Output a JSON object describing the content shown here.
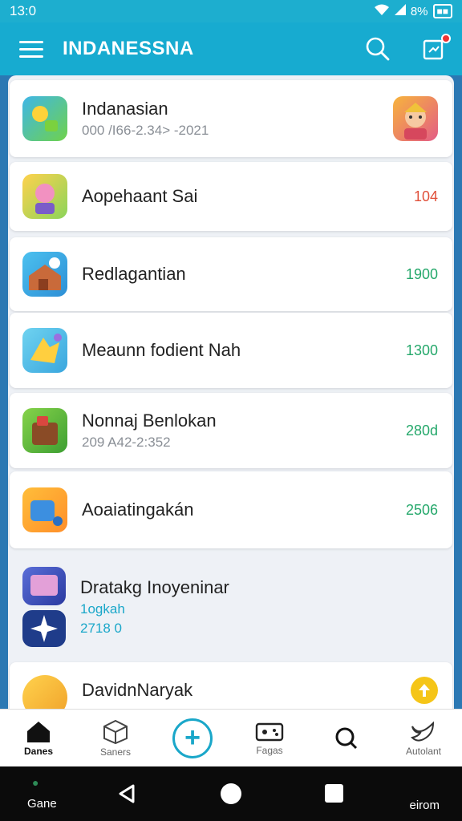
{
  "status": {
    "time": "13:0",
    "battery": "8%"
  },
  "header": {
    "title": "INDANESSNA"
  },
  "items": [
    {
      "name": "Indanasian",
      "sub": "000 /I66-2.34> -2021",
      "value": ""
    },
    {
      "name": "Aopehaant Sai",
      "sub": "",
      "value": "104",
      "value_color": "#e0503a"
    },
    {
      "name": "Redlagantian",
      "sub": "",
      "value": "1900",
      "value_color": "#25a86b"
    },
    {
      "name": "Meaunn fodient Nah",
      "sub": "",
      "value": "1300",
      "value_color": "#25a86b"
    },
    {
      "name": "Nonnaj Benlokan",
      "sub": "209 A42-2:352",
      "value": "280d",
      "value_color": "#25a86b"
    },
    {
      "name": "Aoaiatingakán",
      "sub": "",
      "value": "2506",
      "value_color": "#25a86b"
    },
    {
      "name": "Dratakg Inoyeninar",
      "sub": "1ogkah",
      "sub2": "2718 0",
      "value": ""
    },
    {
      "name": "DavidnNaryak",
      "sub": "",
      "value": ""
    }
  ],
  "bottom_nav": [
    {
      "label": "Danes",
      "icon": "home-icon"
    },
    {
      "label": "Saners",
      "icon": "cube-icon"
    },
    {
      "label": "",
      "icon": "add-icon"
    },
    {
      "label": "Fagas",
      "icon": "gamepad-icon"
    },
    {
      "label": "",
      "icon": "search-icon"
    },
    {
      "label": "Autolant",
      "icon": "bird-icon"
    }
  ],
  "system_nav": {
    "left": "Gane",
    "right": "eirom"
  }
}
